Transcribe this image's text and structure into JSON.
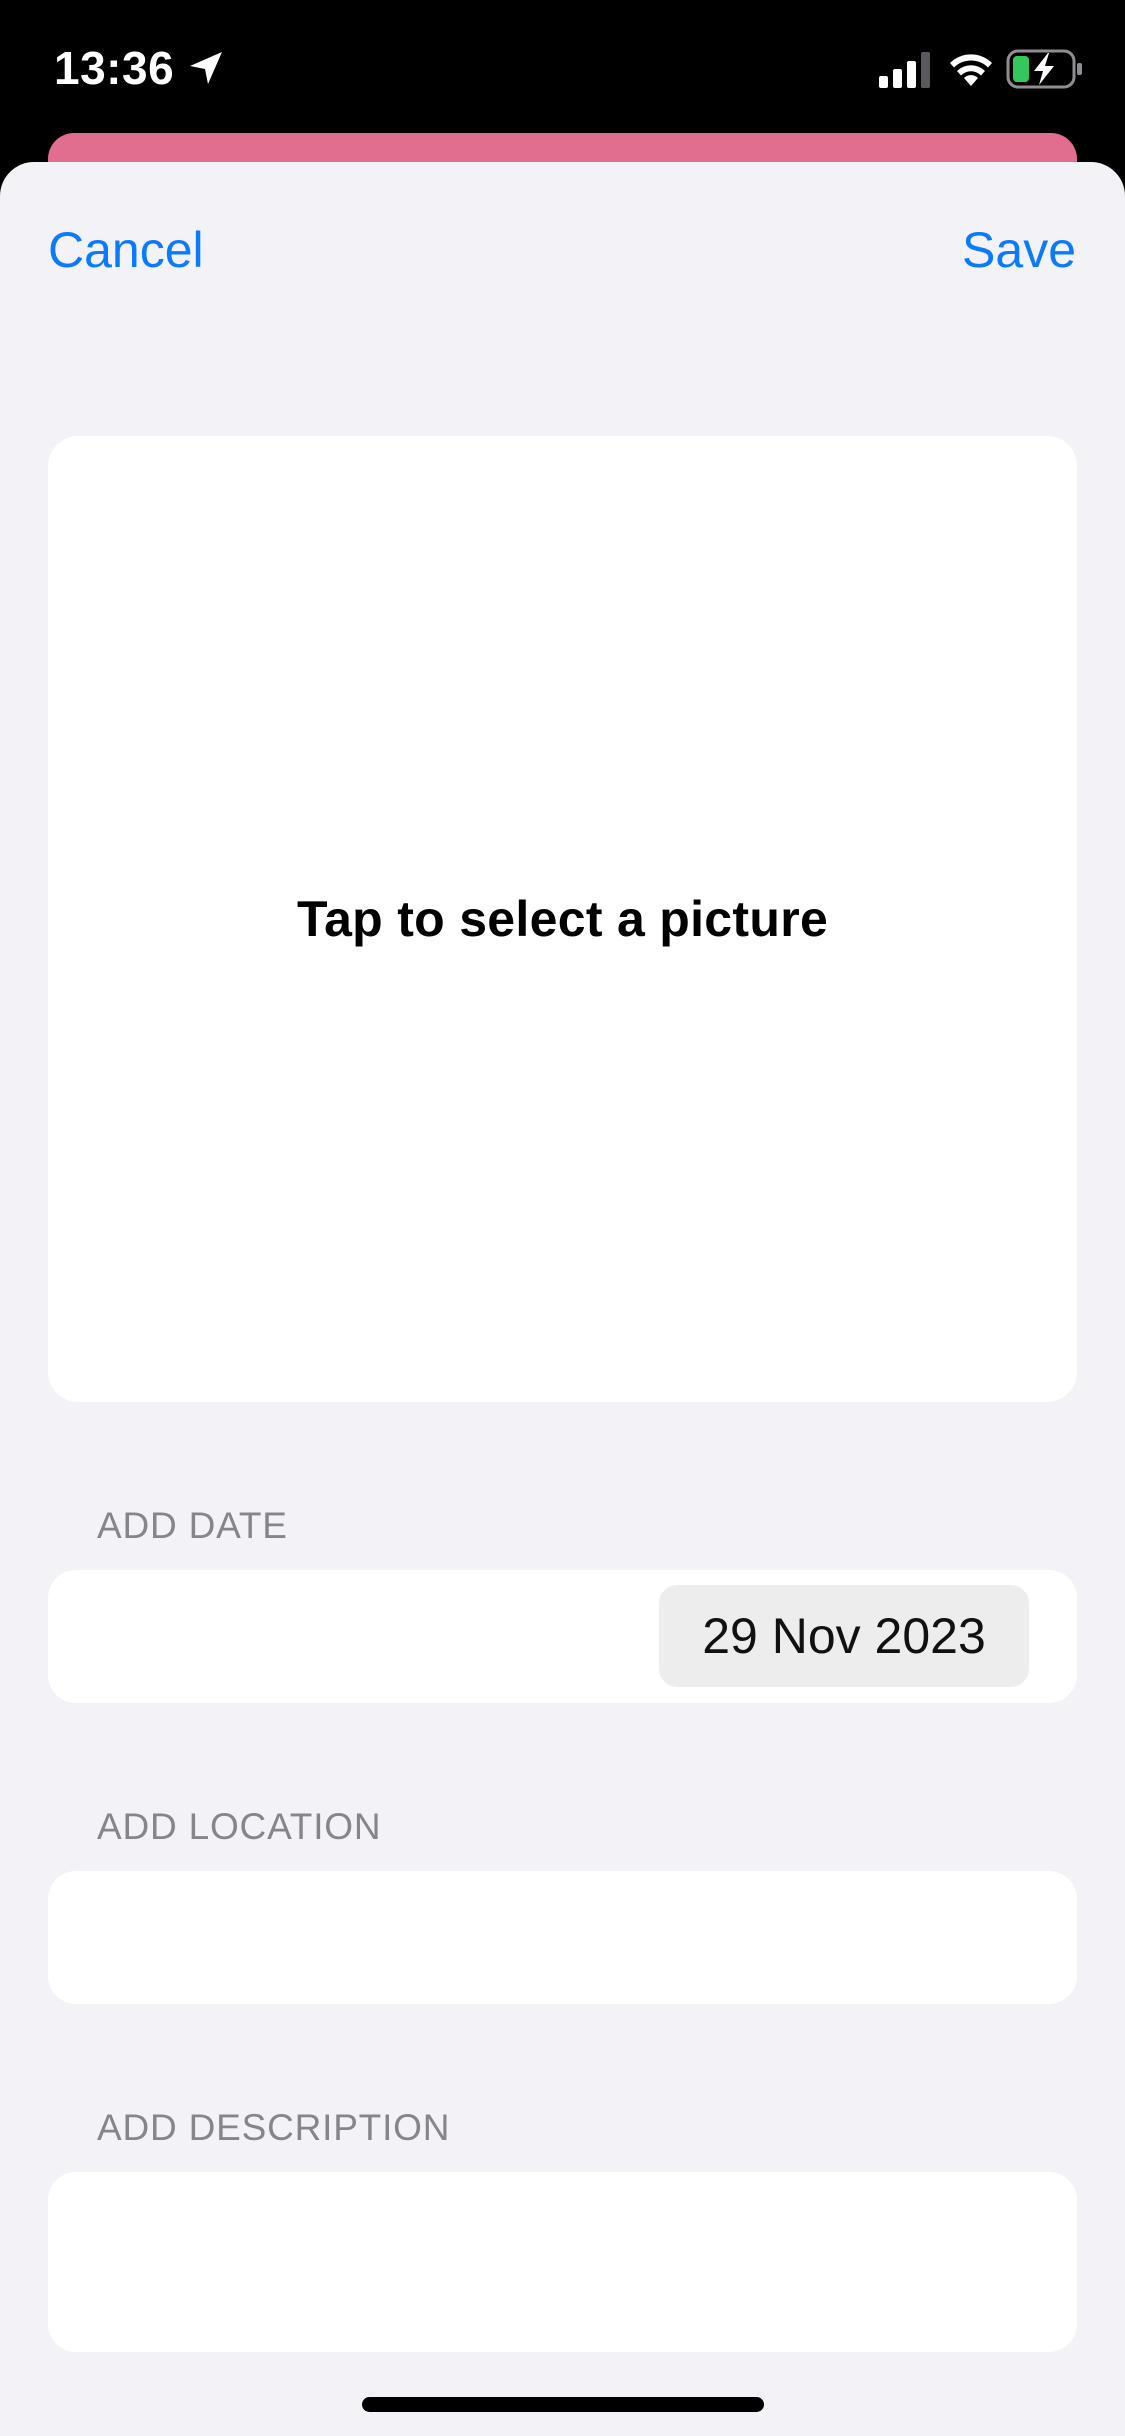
{
  "status_bar": {
    "time": "13:36",
    "icons": [
      "location-arrow-icon",
      "cellular-signal-icon",
      "wifi-icon",
      "battery-charging-icon"
    ],
    "battery_color": "#34c759"
  },
  "nav": {
    "cancel_label": "Cancel",
    "save_label": "Save",
    "accent_color": "#0a7aff"
  },
  "picture": {
    "prompt": "Tap to select a picture"
  },
  "date_section": {
    "header": "ADD DATE",
    "value": "29 Nov 2023"
  },
  "location_section": {
    "header": "ADD LOCATION",
    "value": ""
  },
  "description_section": {
    "header": "ADD DESCRIPTION",
    "value": ""
  },
  "colors": {
    "background_card": "#e16d8f",
    "sheet_background": "#f2f2f7"
  }
}
